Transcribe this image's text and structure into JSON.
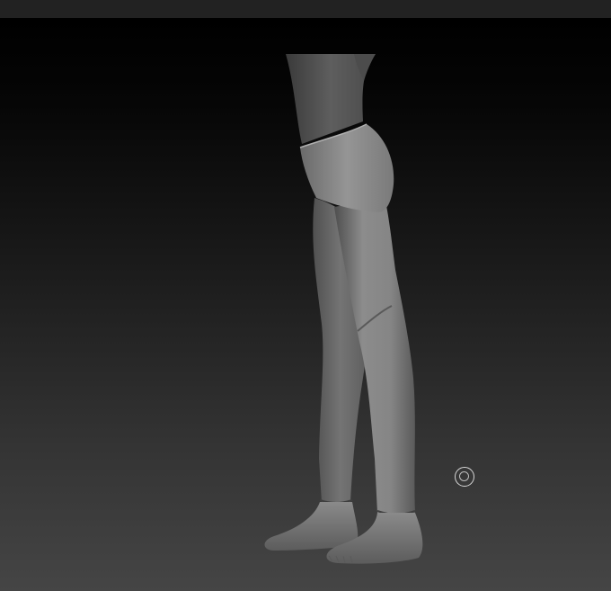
{
  "window": {
    "title": ""
  },
  "viewport": {
    "subject": "legs-sculpt",
    "background_top": "#000000",
    "background_bottom": "#454545",
    "model_color": "#7a7a7a"
  },
  "cursor": {
    "icon": "brush-circle-icon"
  }
}
